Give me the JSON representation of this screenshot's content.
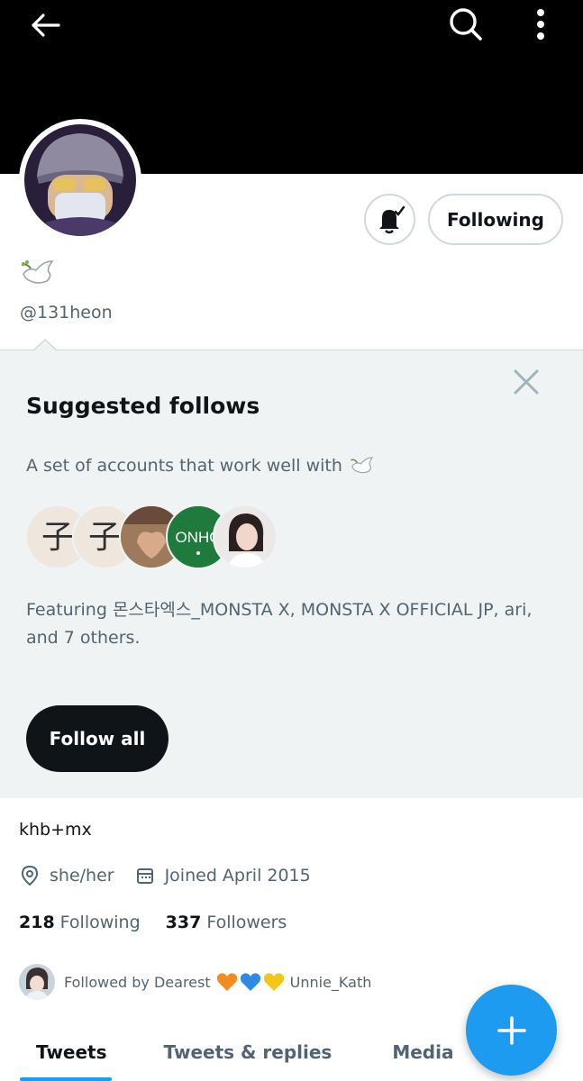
{
  "header": {
    "back_icon": "arrow-left-icon",
    "search_icon": "search-icon",
    "more_icon": "more-vertical-icon"
  },
  "profile": {
    "display_name_icon": "dove-emoji",
    "handle": "@131heon",
    "bell_icon": "bell-check-icon",
    "following_label": "Following",
    "bio": "khb+mx",
    "pronouns": "she/her",
    "joined": "Joined April 2015",
    "following_count": "218",
    "following_label_text": "Following",
    "followers_count": "337",
    "followers_label_text": "Followers",
    "followed_by_prefix": "Followed by Dearest",
    "followed_by_suffix": "Unnie_Kath"
  },
  "suggested": {
    "title": "Suggested follows",
    "subtitle": "A set of accounts that work well with",
    "featuring": "Featuring 몬스타엑스_MONSTA X, MONSTA X OFFICIAL JP, ari, and 7 others.",
    "avatar_texts": [
      "子",
      "子",
      "",
      "ONHO",
      ""
    ],
    "follow_all_label": "Follow all",
    "close_icon": "close-icon"
  },
  "tabs": [
    {
      "label": "Tweets",
      "active": true
    },
    {
      "label": "Tweets & replies",
      "active": false
    },
    {
      "label": "Media",
      "active": false
    }
  ],
  "fab_icon": "plus-icon",
  "colors": {
    "accent": "#1d9bf0",
    "header": "#000000",
    "panel": "#eff3f4",
    "secondary_text": "#536471",
    "primary_text": "#0f1419"
  }
}
